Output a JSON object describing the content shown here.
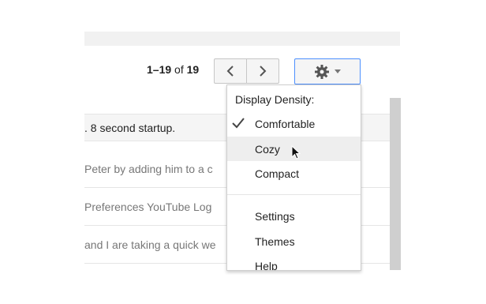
{
  "pager": {
    "range": "1–19",
    "of": "of",
    "total": "19"
  },
  "toolbar": {
    "prev_icon": "chevron-left-icon",
    "next_icon": "chevron-right-icon",
    "settings_icon": "gear-icon"
  },
  "messages": [
    {
      "snippet": ". 8 second startup."
    },
    {
      "snippet": "Peter by adding him to a c"
    },
    {
      "snippet": "Preferences YouTube Log"
    },
    {
      "snippet": "and I are taking a quick we"
    }
  ],
  "menu": {
    "header": "Display Density:",
    "density_options": [
      {
        "label": "Comfortable",
        "checked": true
      },
      {
        "label": "Cozy",
        "hovered": true
      },
      {
        "label": "Compact"
      }
    ],
    "items": [
      {
        "label": "Settings"
      },
      {
        "label": "Themes"
      },
      {
        "label": "Help"
      }
    ]
  }
}
